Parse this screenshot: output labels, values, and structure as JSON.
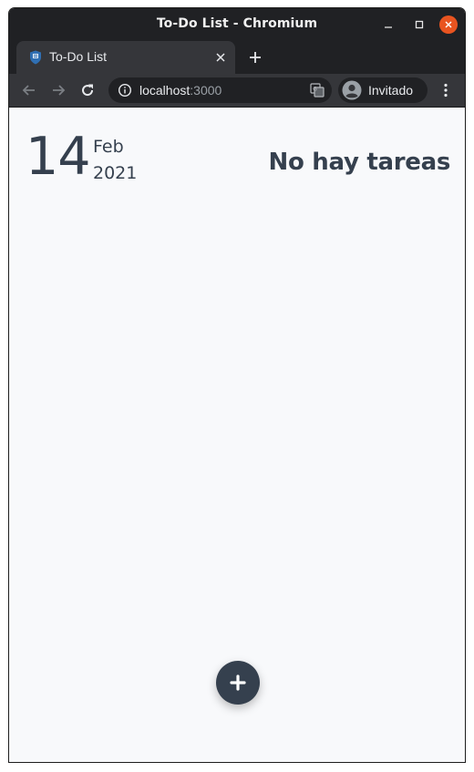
{
  "window": {
    "title": "To-Do List - Chromium"
  },
  "tab": {
    "title": "To-Do List"
  },
  "omnibox": {
    "host": "localhost",
    "port": ":3000"
  },
  "profile": {
    "label": "Invitado"
  },
  "page": {
    "date": {
      "day": "14",
      "month": "Feb",
      "year": "2021"
    },
    "status": "No hay tareas"
  },
  "colors": {
    "accent": "#35404e",
    "background": "#f8f9fb",
    "chrome_dark": "#202124",
    "chrome_mid": "#35363a",
    "close_orange": "#e95420"
  },
  "icons": {
    "fab": "plus-icon"
  }
}
